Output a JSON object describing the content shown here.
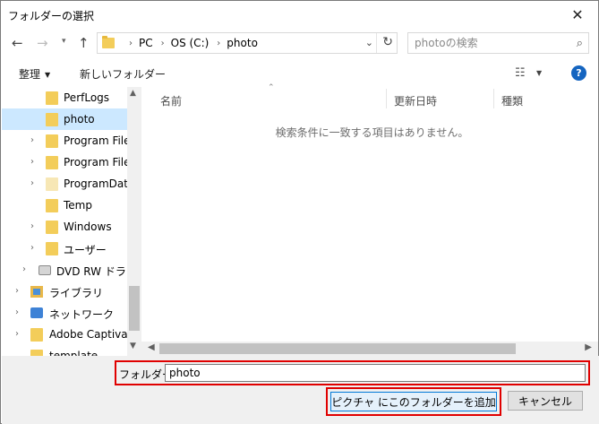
{
  "window": {
    "title": "フォルダーの選択",
    "close_glyph": "✕"
  },
  "address_bar": {
    "breadcrumbs": [
      "PC",
      "OS (C:)",
      "photo"
    ],
    "search_placeholder": "photoの検索"
  },
  "toolbar": {
    "organize_label": "整理",
    "new_folder_label": "新しいフォルダー"
  },
  "nav_tree": {
    "items": [
      {
        "label": "PerfLogs",
        "icon": "folder-icon",
        "expandable": false,
        "selected": false
      },
      {
        "label": "photo",
        "icon": "folder-icon",
        "expandable": false,
        "selected": true
      },
      {
        "label": "Program Files",
        "icon": "folder-icon",
        "expandable": true,
        "selected": false
      },
      {
        "label": "Program Files",
        "icon": "folder-icon",
        "expandable": true,
        "selected": false
      },
      {
        "label": "ProgramData",
        "icon": "folder-icon",
        "expandable": true,
        "selected": false
      },
      {
        "label": "Temp",
        "icon": "folder-icon",
        "expandable": false,
        "selected": false
      },
      {
        "label": "Windows",
        "icon": "folder-icon",
        "expandable": true,
        "selected": false
      },
      {
        "label": "ユーザー",
        "icon": "folder-icon",
        "expandable": true,
        "selected": false
      },
      {
        "label": "DVD RW ドライブ",
        "icon": "dvd-drive-icon",
        "expandable": true,
        "selected": false
      },
      {
        "label": "ライブラリ",
        "icon": "library-icon",
        "expandable": true,
        "selected": false
      },
      {
        "label": "ネットワーク",
        "icon": "network-icon",
        "expandable": true,
        "selected": false
      },
      {
        "label": "Adobe Captivate",
        "icon": "folder-icon",
        "expandable": true,
        "selected": false
      },
      {
        "label": "template",
        "icon": "folder-icon",
        "expandable": false,
        "selected": false
      }
    ]
  },
  "file_list": {
    "columns": [
      "名前",
      "更新日時",
      "種類"
    ],
    "empty_message": "検索条件に一致する項目はありません。"
  },
  "footer": {
    "folder_label": "フォルダー:",
    "folder_value": "photo",
    "add_button_label": "ピクチャ にこのフォルダーを追加",
    "cancel_button_label": "キャンセル"
  },
  "colors": {
    "highlight_border": "#e00000",
    "selection_bg": "#cce8ff",
    "primary_button_border": "#0078d7"
  }
}
